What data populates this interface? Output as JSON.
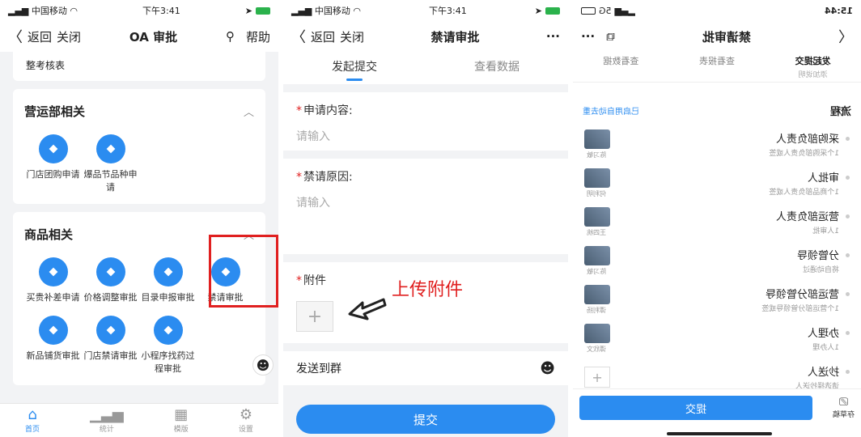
{
  "status": {
    "carrier": "中国移动",
    "time": "下午3:41"
  },
  "panel1": {
    "nav": {
      "back": "返回",
      "close": "关闭",
      "title": "OA 审批",
      "help": "帮助"
    },
    "top_item": "整考核表",
    "section_ops": {
      "title": "营运部相关",
      "apps": [
        "门店团购申请",
        "爆品节品种申请"
      ]
    },
    "section_goods": {
      "title": "商品相关",
      "apps": [
        "买贵补差申请",
        "价格调整审批",
        "目录申报审批",
        "禁请审批",
        "新品铺货审批",
        "门店禁请审批",
        "小程序找药过程审批"
      ]
    },
    "tabs": [
      "首页",
      "统计",
      "模版",
      "设置"
    ]
  },
  "panel2": {
    "nav": {
      "back": "返回",
      "close": "关闭",
      "title": "禁请审批",
      "more": "···"
    },
    "tabs": [
      "发起提交",
      "查看数据"
    ],
    "fields": [
      {
        "label": "申请内容:",
        "placeholder": "请输入"
      },
      {
        "label": "禁请原因:",
        "placeholder": "请输入"
      }
    ],
    "attachment_label": "附件",
    "annotation": "上传附件",
    "send_to_group": "发送到群",
    "submit": "提交"
  },
  "panel3": {
    "time": "15:44",
    "signal": "5G",
    "title": "禁请审批",
    "tabs": [
      "发起提交",
      "查看报表",
      "查看数据"
    ],
    "partial_text": "添加说明",
    "flow_title": "流程",
    "flow_link": "已启用自动去重",
    "flow": [
      {
        "name": "采购部负责人",
        "sub": "1个采购部负责人或签",
        "person": "陈习敏"
      },
      {
        "name": "审批人",
        "sub": "1个商品部负责人或签",
        "person": "何利明"
      },
      {
        "name": "营运部负责人",
        "sub": "1人审批",
        "person": "王四桃"
      },
      {
        "name": "分管领导",
        "sub": "将自动通过",
        "person": "陈习敏"
      },
      {
        "name": "营运部分管领导",
        "sub": "1个营运部分管领导或签",
        "person": "谭利扬"
      },
      {
        "name": "办理人",
        "sub": "1人办理",
        "person": "谭欣文"
      },
      {
        "name": "抄送人",
        "sub": "请选择抄送人",
        "person": ""
      }
    ],
    "draft": "存草稿",
    "submit": "提交"
  }
}
